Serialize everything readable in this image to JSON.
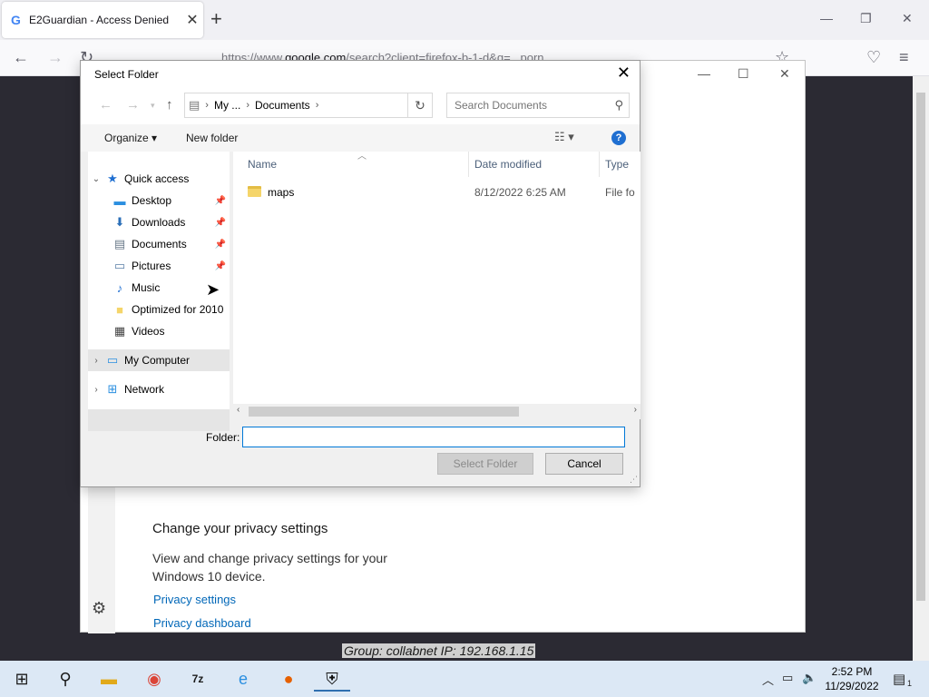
{
  "browser": {
    "tab_title": "E2Guardian - Access Denied",
    "tab_icon": "G",
    "url_prefix": "https://www.",
    "url_host": "google.com",
    "url_rest": "/search?client=firefox-b-1-d&q=...porn"
  },
  "settings": {
    "privacy_title": "Change your privacy settings",
    "privacy_desc": "View and change privacy settings for your Windows 10 device.",
    "privacy_settings_link": "Privacy settings",
    "privacy_dashboard_link": "Privacy dashboard"
  },
  "page": {
    "group_text": "Group: collabnet   IP: 192.168.1.15"
  },
  "dialog": {
    "title": "Select Folder",
    "breadcrumb": [
      "My ...",
      "Documents"
    ],
    "search_placeholder": "Search Documents",
    "organize_label": "Organize ▾",
    "new_folder_label": "New folder",
    "columns": {
      "name": "Name",
      "date": "Date modified",
      "type": "Type"
    },
    "files": [
      {
        "name": "maps",
        "date": "8/12/2022 6:25 AM",
        "type": "File fo"
      }
    ],
    "nav": {
      "quick_access": "Quick access",
      "items": [
        "Desktop",
        "Downloads",
        "Documents",
        "Pictures",
        "Music",
        "Optimized for 2010",
        "Videos"
      ],
      "my_computer": "My Computer",
      "network": "Network"
    },
    "folder_label": "Folder:",
    "folder_value": "",
    "select_button": "Select Folder",
    "cancel_button": "Cancel"
  },
  "taskbar": {
    "time": "2:52 PM",
    "date": "11/29/2022",
    "notification_count": "1"
  }
}
